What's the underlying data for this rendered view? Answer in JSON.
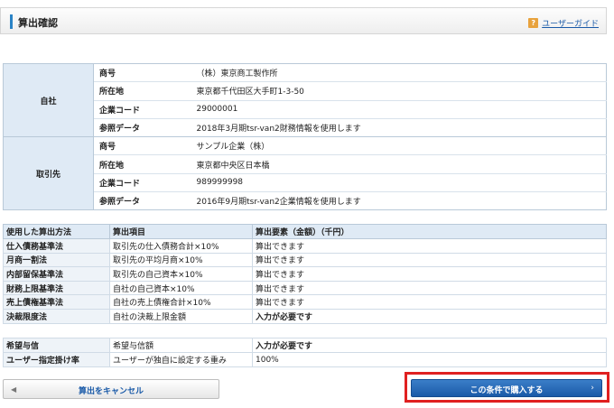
{
  "header": {
    "title": "算出確認",
    "guide_label": "ユーザーガイド"
  },
  "company": {
    "self": {
      "group_label": "自社",
      "rows": [
        {
          "key": "商号",
          "value": "（株）東京商工製作所"
        },
        {
          "key": "所在地",
          "value": "東京都千代田区大手町1-3-50"
        },
        {
          "key": "企業コード",
          "value": "29000001"
        },
        {
          "key": "参照データ",
          "value": "2018年3月期tsr-van2財務情報を使用します"
        }
      ]
    },
    "partner": {
      "group_label": "取引先",
      "rows": [
        {
          "key": "商号",
          "value": "サンプル企業（株）"
        },
        {
          "key": "所在地",
          "value": "東京都中央区日本橋"
        },
        {
          "key": "企業コード",
          "value": "989999998"
        },
        {
          "key": "参照データ",
          "value": "2016年9月期tsr-van2企業情報を使用します"
        }
      ]
    }
  },
  "method": {
    "headers": [
      "使用した算出方法",
      "算出項目",
      "算出要素（金額）（千円）"
    ],
    "rows": [
      {
        "name": "仕入債務基準法",
        "item": "取引先の仕入債務合計×10%",
        "status": "算出できます"
      },
      {
        "name": "月商一割法",
        "item": "取引先の平均月商×10%",
        "status": "算出できます"
      },
      {
        "name": "内部留保基準法",
        "item": "取引先の自己資本×10%",
        "status": "算出できます"
      },
      {
        "name": "財務上限基準法",
        "item": "自社の自己資本×10%",
        "status": "算出できます"
      },
      {
        "name": "売上債権基準法",
        "item": "自社の売上債権合計×10%",
        "status": "算出できます"
      },
      {
        "name": "決裁限度法",
        "item": "自社の決裁上限金額",
        "status": "入力が必要です"
      }
    ]
  },
  "desired": {
    "rows": [
      {
        "name": "希望与信",
        "item": "希望与信額",
        "status": "入力が必要です"
      },
      {
        "name": "ユーザー指定掛け率",
        "item": "ユーザーが独自に設定する重み",
        "status": "100%"
      }
    ]
  },
  "buttons": {
    "cancel_label": "算出をキャンセル",
    "buy_label": "この条件で購入する"
  },
  "colors": {
    "accent": "#2a83c6",
    "highlight_border": "#e02020",
    "primary_button": "#1a5aa8"
  }
}
